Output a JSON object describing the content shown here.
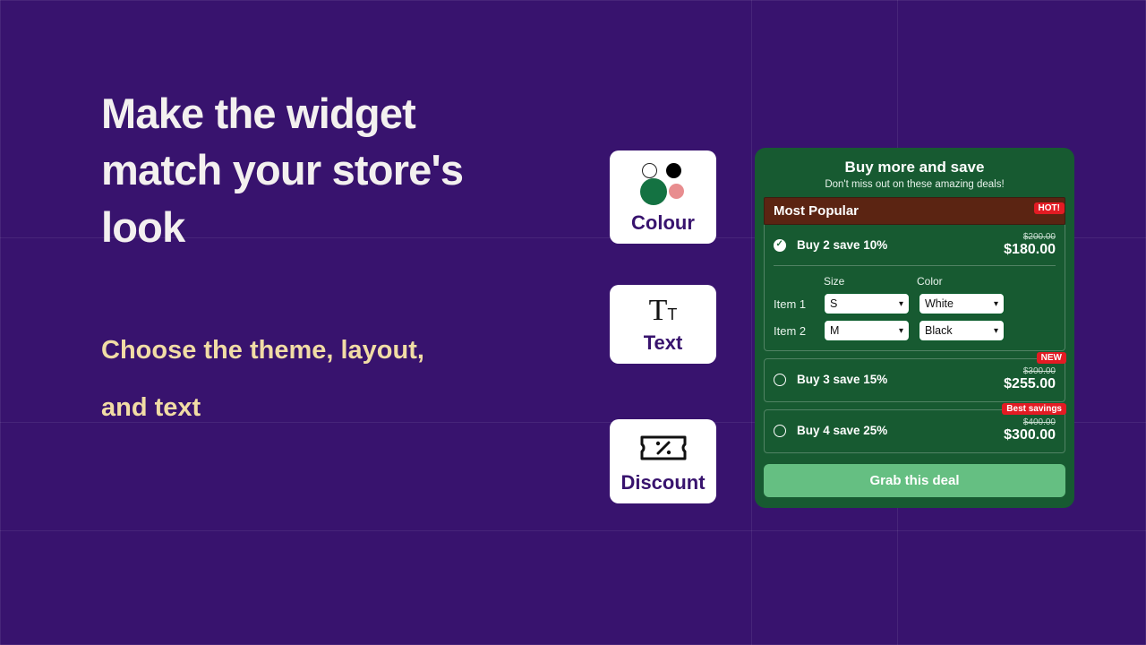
{
  "headline_l1": "Make the widget",
  "headline_l2": "match your store's",
  "headline_l3": "look",
  "subtitle_l1": "Choose the theme, layout,",
  "subtitle_l2": "and text",
  "cards": {
    "colour": "Colour",
    "text": "Text",
    "discount": "Discount"
  },
  "widget": {
    "title": "Buy more and save",
    "subtitle": "Don't miss out on these amazing deals!",
    "banner_title": "Most Popular",
    "banner_badge": "HOT!",
    "deals": [
      {
        "label": "Buy 2 save 10%",
        "old": "$200.00",
        "new": "$180.00",
        "selected": true,
        "badge": ""
      },
      {
        "label": "Buy 3 save 15%",
        "old": "$300.00",
        "new": "$255.00",
        "selected": false,
        "badge": "NEW"
      },
      {
        "label": "Buy 4 save 25%",
        "old": "$400.00",
        "new": "$300.00",
        "selected": false,
        "badge": "Best savings"
      }
    ],
    "variants": {
      "head_size": "Size",
      "head_color": "Color",
      "rows": [
        {
          "item": "Item 1",
          "size": "S",
          "color": "White"
        },
        {
          "item": "Item 2",
          "size": "M",
          "color": "Black"
        }
      ]
    },
    "cta": "Grab this deal"
  }
}
